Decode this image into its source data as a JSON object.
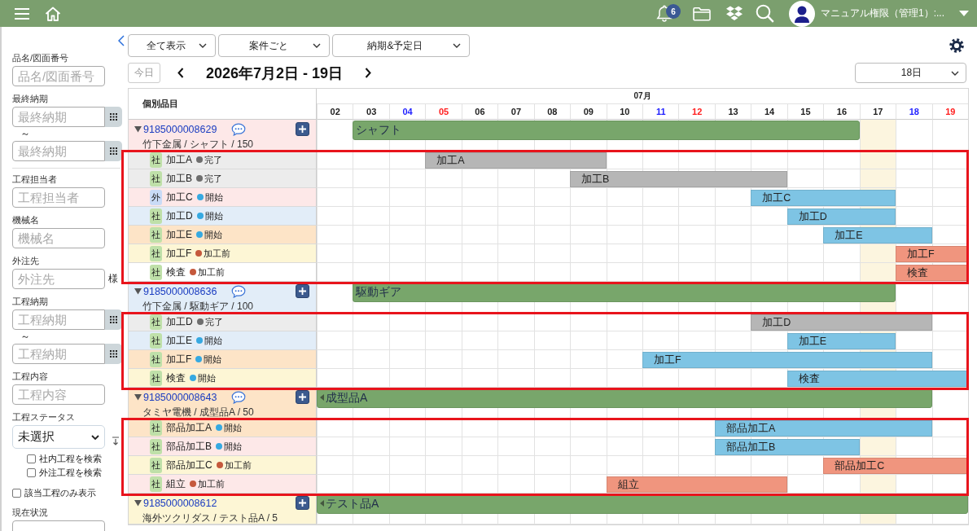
{
  "header": {
    "notification_count": "6",
    "user_name": "マニュアル権限（管理1）:..."
  },
  "sidebar": {
    "groups": [
      {
        "fields": [
          {
            "kind": "text",
            "label": "品名/図面番号",
            "placeholder": "品名/図面番号"
          },
          {
            "kind": "date_range",
            "label": "最終納期",
            "from_placeholder": "最終納期",
            "separator": "～",
            "to_placeholder": "最終納期"
          }
        ]
      },
      {
        "fields": [
          {
            "kind": "text",
            "label": "工程担当者",
            "placeholder": "工程担当者"
          },
          {
            "kind": "text",
            "label": "機械名",
            "placeholder": "機械名"
          },
          {
            "kind": "text",
            "label": "外注先",
            "placeholder": "外注先",
            "suffix": "様"
          },
          {
            "kind": "date_range",
            "label": "工程納期",
            "from_placeholder": "工程納期",
            "separator": "～",
            "to_placeholder": "工程納期"
          },
          {
            "kind": "text",
            "label": "工程内容",
            "placeholder": "工程内容"
          },
          {
            "kind": "select",
            "label": "工程ステータス",
            "value": "未選択",
            "checkboxes": [
              {
                "label": "社内工程を検索",
                "checked": false
              },
              {
                "label": "外注工程を検索",
                "checked": false
              }
            ]
          },
          {
            "kind": "checkbox",
            "label": "該当工程のみ表示",
            "checked": false
          },
          {
            "kind": "text",
            "label": "現在状況"
          }
        ]
      }
    ]
  },
  "toolbar": {
    "dropdowns": [
      {
        "value": "全て表示"
      },
      {
        "value": "案件ごと"
      },
      {
        "value": "納期&予定日"
      }
    ],
    "today_button": {
      "label": "今日",
      "disabled": true
    },
    "title": "2026年7月2日 - 19日",
    "range_select": {
      "value": "18日"
    }
  },
  "gantt": {
    "column_header": "個別品目",
    "month": "07月",
    "days": [
      {
        "label": "02",
        "kind": "weekday",
        "today": false
      },
      {
        "label": "03",
        "kind": "weekday",
        "today": false
      },
      {
        "label": "04",
        "kind": "saturday",
        "today": false
      },
      {
        "label": "05",
        "kind": "sunday",
        "today": false
      },
      {
        "label": "06",
        "kind": "weekday",
        "today": false
      },
      {
        "label": "07",
        "kind": "weekday",
        "today": false
      },
      {
        "label": "08",
        "kind": "weekday",
        "today": false
      },
      {
        "label": "09",
        "kind": "weekday",
        "today": false
      },
      {
        "label": "10",
        "kind": "weekday",
        "today": false
      },
      {
        "label": "11",
        "kind": "saturday",
        "today": false
      },
      {
        "label": "12",
        "kind": "sunday",
        "today": false
      },
      {
        "label": "13",
        "kind": "weekday",
        "today": false
      },
      {
        "label": "14",
        "kind": "weekday",
        "today": false
      },
      {
        "label": "15",
        "kind": "weekday",
        "today": false
      },
      {
        "label": "16",
        "kind": "weekday",
        "today": false
      },
      {
        "label": "17",
        "kind": "weekday",
        "today": true
      },
      {
        "label": "18",
        "kind": "saturday",
        "today": false
      },
      {
        "label": "19",
        "kind": "sunday",
        "today": false
      }
    ],
    "products": [
      {
        "id": "9185000008629",
        "expanded": true,
        "has_comment": true,
        "subtitle": "竹下金属 / シャフト / 150",
        "color": "#fde8e8",
        "bar": {
          "label": "シャフト",
          "continues_before": false,
          "days": [
            false,
            true,
            true,
            true,
            true,
            true,
            true,
            true,
            true,
            true,
            true,
            true,
            true,
            true,
            true,
            false,
            false,
            false
          ]
        },
        "highlighted": true,
        "processes": [
          {
            "kind": "internal",
            "badge": "社",
            "name": "加工A",
            "status": {
              "label": "完了",
              "color": "#6e6e6e"
            },
            "color": "#ececec",
            "bar": {
              "label": "加工A",
              "color": "#b6b6b6",
              "days": [
                false,
                false,
                false,
                true,
                true,
                true,
                true,
                true,
                false,
                false,
                false,
                false,
                false,
                false,
                false,
                false,
                false,
                false
              ]
            }
          },
          {
            "kind": "internal",
            "badge": "社",
            "name": "加工B",
            "status": {
              "label": "完了",
              "color": "#6e6e6e"
            },
            "color": "#ececec",
            "bar": {
              "label": "加工B",
              "color": "#b6b6b6",
              "days": [
                false,
                false,
                false,
                false,
                false,
                false,
                false,
                true,
                true,
                true,
                true,
                true,
                true,
                false,
                false,
                false,
                false,
                false
              ]
            }
          },
          {
            "kind": "external",
            "badge": "外",
            "name": "加工C",
            "status": {
              "label": "開始",
              "color": "#36a9e1"
            },
            "color": "#fde8e8",
            "bar": {
              "label": "加工C",
              "color": "#7ec4e4",
              "days": [
                false,
                false,
                false,
                false,
                false,
                false,
                false,
                false,
                false,
                false,
                false,
                false,
                true,
                true,
                true,
                true,
                false,
                false
              ]
            }
          },
          {
            "kind": "internal",
            "badge": "社",
            "name": "加工D",
            "status": {
              "label": "開始",
              "color": "#36a9e1"
            },
            "color": "#e2edf8",
            "bar": {
              "label": "加工D",
              "color": "#7ec4e4",
              "days": [
                false,
                false,
                false,
                false,
                false,
                false,
                false,
                false,
                false,
                false,
                false,
                false,
                false,
                true,
                true,
                true,
                false,
                false
              ]
            }
          },
          {
            "kind": "internal",
            "badge": "社",
            "name": "加工E",
            "status": {
              "label": "開始",
              "color": "#36a9e1"
            },
            "color": "#fde4c7",
            "bar": {
              "label": "加工E",
              "color": "#7ec4e4",
              "days": [
                false,
                false,
                false,
                false,
                false,
                false,
                false,
                false,
                false,
                false,
                false,
                false,
                false,
                false,
                true,
                true,
                true,
                false
              ]
            }
          },
          {
            "kind": "internal",
            "badge": "社",
            "name": "加工F",
            "status": {
              "label": "加工前",
              "color": "#c5593c"
            },
            "color": "#fdf6d5",
            "bar": {
              "label": "加工F",
              "color": "#f0957e",
              "days": [
                false,
                false,
                false,
                false,
                false,
                false,
                false,
                false,
                false,
                false,
                false,
                false,
                false,
                false,
                false,
                false,
                true,
                true
              ]
            }
          },
          {
            "kind": "internal",
            "badge": "社",
            "name": "検査",
            "status": {
              "label": "加工前",
              "color": "#c5593c"
            },
            "color": "#ffffff",
            "bar": {
              "label": "検査",
              "color": "#f0957e",
              "days": [
                false,
                false,
                false,
                false,
                false,
                false,
                false,
                false,
                false,
                false,
                false,
                false,
                false,
                false,
                false,
                false,
                true,
                true
              ]
            }
          }
        ]
      },
      {
        "id": "9185000008636",
        "expanded": true,
        "has_comment": true,
        "subtitle": "竹下金属 / 駆動ギア / 100",
        "color": "#e2edf8",
        "bar": {
          "label": "駆動ギア",
          "continues_before": false,
          "days": [
            false,
            true,
            true,
            true,
            true,
            true,
            true,
            true,
            true,
            true,
            true,
            true,
            true,
            true,
            true,
            true,
            false,
            false
          ]
        },
        "highlighted": true,
        "processes": [
          {
            "kind": "internal",
            "badge": "社",
            "name": "加工D",
            "status": {
              "label": "完了",
              "color": "#6e6e6e"
            },
            "color": "#ececec",
            "bar": {
              "label": "加工D",
              "color": "#b6b6b6",
              "days": [
                false,
                false,
                false,
                false,
                false,
                false,
                false,
                false,
                false,
                false,
                false,
                false,
                true,
                true,
                true,
                true,
                true,
                false
              ]
            }
          },
          {
            "kind": "internal",
            "badge": "社",
            "name": "加工E",
            "status": {
              "label": "開始",
              "color": "#36a9e1"
            },
            "color": "#e2edf8",
            "bar": {
              "label": "加工E",
              "color": "#7ec4e4",
              "days": [
                false,
                false,
                false,
                false,
                false,
                false,
                false,
                false,
                false,
                false,
                false,
                false,
                false,
                true,
                true,
                true,
                false,
                false
              ]
            }
          },
          {
            "kind": "internal",
            "badge": "社",
            "name": "加工F",
            "status": {
              "label": "開始",
              "color": "#36a9e1"
            },
            "color": "#fde4c7",
            "bar": {
              "label": "加工F",
              "color": "#7ec4e4",
              "days": [
                false,
                false,
                false,
                false,
                false,
                false,
                false,
                false,
                false,
                true,
                true,
                true,
                true,
                true,
                true,
                true,
                true,
                false
              ]
            }
          },
          {
            "kind": "internal",
            "badge": "社",
            "name": "検査",
            "status": {
              "label": "開始",
              "color": "#36a9e1"
            },
            "color": "#fdf6d5",
            "bar": {
              "label": "検査",
              "color": "#7ec4e4",
              "days": [
                false,
                false,
                false,
                false,
                false,
                false,
                false,
                false,
                false,
                false,
                false,
                false,
                false,
                true,
                true,
                true,
                true,
                true
              ]
            }
          }
        ]
      },
      {
        "id": "9185000008643",
        "expanded": true,
        "has_comment": true,
        "subtitle": "タミヤ電機 / 成型品A / 50",
        "color": "#fde4c7",
        "bar": {
          "label": "成型品A",
          "continues_before": true,
          "days": [
            true,
            true,
            true,
            true,
            true,
            true,
            true,
            true,
            true,
            true,
            true,
            true,
            true,
            true,
            true,
            true,
            true,
            false
          ]
        },
        "highlighted": true,
        "processes": [
          {
            "kind": "internal",
            "badge": "社",
            "name": "部品加工A",
            "status": {
              "label": "開始",
              "color": "#36a9e1"
            },
            "color": "#fde4c7",
            "bar": {
              "label": "部品加工A",
              "color": "#7ec4e4",
              "days": [
                false,
                false,
                false,
                false,
                false,
                false,
                false,
                false,
                false,
                false,
                false,
                true,
                true,
                true,
                true,
                true,
                true,
                false
              ]
            }
          },
          {
            "kind": "internal",
            "badge": "社",
            "name": "部品加工B",
            "status": {
              "label": "開始",
              "color": "#36a9e1"
            },
            "color": "#fde8e8",
            "bar": {
              "label": "部品加工B",
              "color": "#7ec4e4",
              "days": [
                false,
                false,
                false,
                false,
                false,
                false,
                false,
                false,
                false,
                false,
                false,
                true,
                true,
                true,
                true,
                false,
                false,
                false
              ]
            }
          },
          {
            "kind": "internal",
            "badge": "社",
            "name": "部品加工C",
            "status": {
              "label": "加工前",
              "color": "#c5593c"
            },
            "color": "#fdf6d5",
            "bar": {
              "label": "部品加工C",
              "color": "#f0957e",
              "days": [
                false,
                false,
                false,
                false,
                false,
                false,
                false,
                false,
                false,
                false,
                false,
                false,
                false,
                false,
                true,
                true,
                true,
                true
              ]
            }
          },
          {
            "kind": "internal",
            "badge": "社",
            "name": "組立",
            "status": {
              "label": "加工前",
              "color": "#c5593c"
            },
            "color": "#fde8e8",
            "bar": {
              "label": "組立",
              "color": "#f0957e",
              "days": [
                false,
                false,
                false,
                false,
                false,
                false,
                false,
                false,
                true,
                true,
                true,
                true,
                true,
                false,
                false,
                false,
                false,
                false
              ]
            }
          }
        ]
      },
      {
        "id": "9185000008612",
        "expanded": true,
        "has_comment": false,
        "subtitle": "海外ツクリダス / テスト品A / 5",
        "color": "#fdf6d5",
        "bar": {
          "label": "テスト品A",
          "continues_before": true,
          "days": [
            true,
            true,
            true,
            true,
            true,
            true,
            true,
            true,
            true,
            true,
            true,
            true,
            true,
            true,
            true,
            true,
            true,
            true
          ]
        }
      }
    ]
  }
}
